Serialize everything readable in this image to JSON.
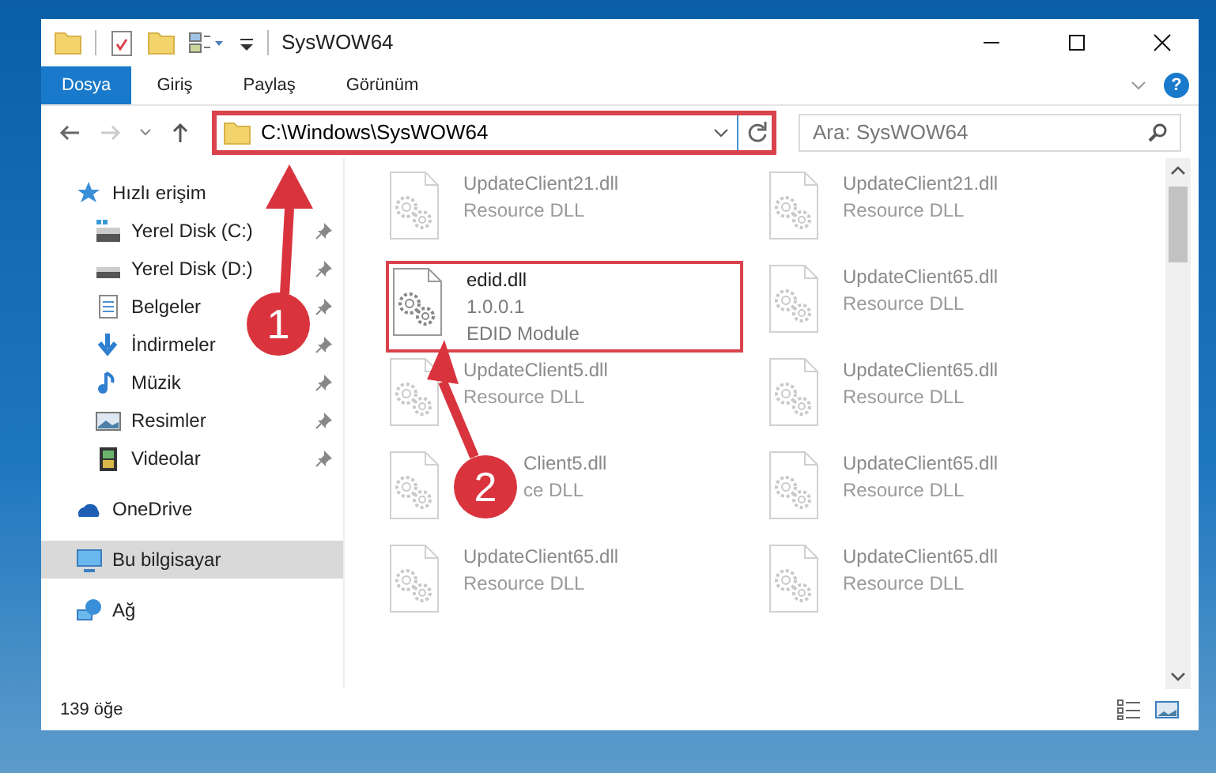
{
  "window": {
    "title": "SysWOW64"
  },
  "ribbon": {
    "tabs": [
      {
        "label": "Dosya",
        "kind": "file-menu",
        "selected": false
      },
      {
        "label": "Giriş",
        "kind": "tab",
        "selected": false
      },
      {
        "label": "Paylaş",
        "kind": "tab",
        "selected": false
      },
      {
        "label": "Görünüm",
        "kind": "tab",
        "selected": false
      }
    ],
    "help": "?"
  },
  "address_bar": {
    "path": "C:\\Windows\\SysWOW64",
    "highlighted": true
  },
  "search": {
    "placeholder": "Ara: SysWOW64"
  },
  "sidebar": {
    "items": [
      {
        "label": "Hızlı erişim",
        "kind": "quick-access",
        "selected": false,
        "children": [
          {
            "label": "Yerel Disk (C:)",
            "kind": "system-drive",
            "pinned": true,
            "selected": false
          },
          {
            "label": "Yerel Disk (D:)",
            "kind": "drive",
            "pinned": true,
            "selected": false
          },
          {
            "label": "Belgeler",
            "kind": "documents",
            "pinned": true,
            "selected": false
          },
          {
            "label": "İndirmeler",
            "kind": "downloads",
            "pinned": true,
            "selected": false
          },
          {
            "label": "Müzik",
            "kind": "music",
            "pinned": true,
            "selected": false
          },
          {
            "label": "Resimler",
            "kind": "pictures",
            "pinned": true,
            "selected": false
          },
          {
            "label": "Videolar",
            "kind": "videos",
            "pinned": true,
            "selected": false
          }
        ]
      },
      {
        "label": "OneDrive",
        "kind": "cloud",
        "selected": false
      },
      {
        "label": "Bu bilgisayar",
        "kind": "computer",
        "selected": true
      },
      {
        "label": "Ağ",
        "kind": "network",
        "selected": false
      }
    ]
  },
  "files": [
    {
      "name": "UpdateClient21.dll",
      "details": [
        "Resource DLL"
      ],
      "blurred": true,
      "highlighted": false
    },
    {
      "name": "UpdateClient21.dll",
      "details": [
        "Resource DLL"
      ],
      "blurred": true,
      "highlighted": false
    },
    {
      "name": "edid.dll",
      "details": [
        "1.0.0.1",
        "EDID Module"
      ],
      "blurred": false,
      "highlighted": true
    },
    {
      "name": "UpdateClient65.dll",
      "details": [
        "Resource DLL"
      ],
      "blurred": true,
      "highlighted": false
    },
    {
      "name": "UpdateClient5.dll",
      "details": [
        "Resource DLL"
      ],
      "blurred": true,
      "highlighted": false
    },
    {
      "name": "UpdateClient65.dll",
      "details": [
        "Resource DLL"
      ],
      "blurred": true,
      "highlighted": false
    },
    {
      "name": "Client5.dll",
      "details": [
        "ce DLL"
      ],
      "blurred": true,
      "highlighted": false,
      "kind": "partly-covered"
    },
    {
      "name": "UpdateClient65.dll",
      "details": [
        "Resource DLL"
      ],
      "blurred": true,
      "highlighted": false
    },
    {
      "name": "UpdateClient65.dll",
      "details": [
        "Resource DLL"
      ],
      "blurred": true,
      "highlighted": false
    },
    {
      "name": "UpdateClient65.dll",
      "details": [
        "Resource DLL"
      ],
      "blurred": true,
      "highlighted": false
    }
  ],
  "status_bar": {
    "count": "139 öğe"
  },
  "annotations": [
    {
      "number": "1"
    },
    {
      "number": "2"
    }
  ]
}
